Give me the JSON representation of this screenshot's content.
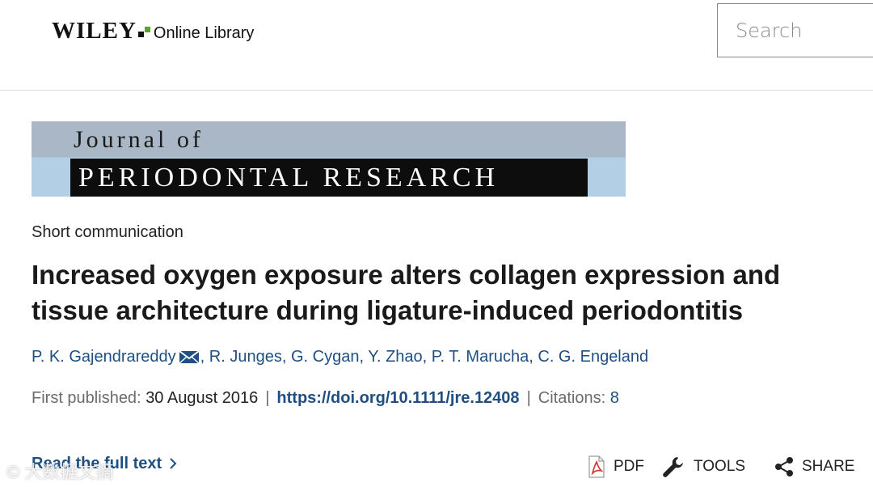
{
  "header": {
    "logo_wiley": "WILEY",
    "logo_online_library": "Online Library",
    "search_placeholder": "Search"
  },
  "banner": {
    "line1": "Journal of",
    "line2": "PERIODONTAL RESEARCH"
  },
  "article": {
    "type": "Short communication",
    "title": "Increased oxygen exposure alters collagen expression and tissue architecture during ligature-induced periodontitis",
    "authors": [
      "P. K. Gajendrareddy",
      "R. Junges",
      "G. Cygan",
      "Y. Zhao",
      "P. T. Marucha",
      "C. G. Engeland"
    ],
    "author_separator": ", ",
    "first_published_label": "First published:",
    "first_published_date": "30 August 2016",
    "doi": "https://doi.org/10.1111/jre.12408",
    "citations_label": "Citations:",
    "citations_count": "8",
    "pipe": "|"
  },
  "actions": {
    "read_full_text": "Read the full text",
    "pdf": "PDF",
    "tools": "TOOLS",
    "share": "SHARE"
  },
  "icons": {
    "mail": "mail-icon",
    "chevron": "chevron-right-icon",
    "pdf": "pdf-icon",
    "tools": "wrench-icon",
    "share": "share-icon"
  },
  "colors": {
    "link": "#1f4f82",
    "logo_green": "#5aa32b",
    "banner_top": "#a9b7c7",
    "banner_bottom": "#b3cfe6"
  },
  "watermark": "© 大数据文摘"
}
